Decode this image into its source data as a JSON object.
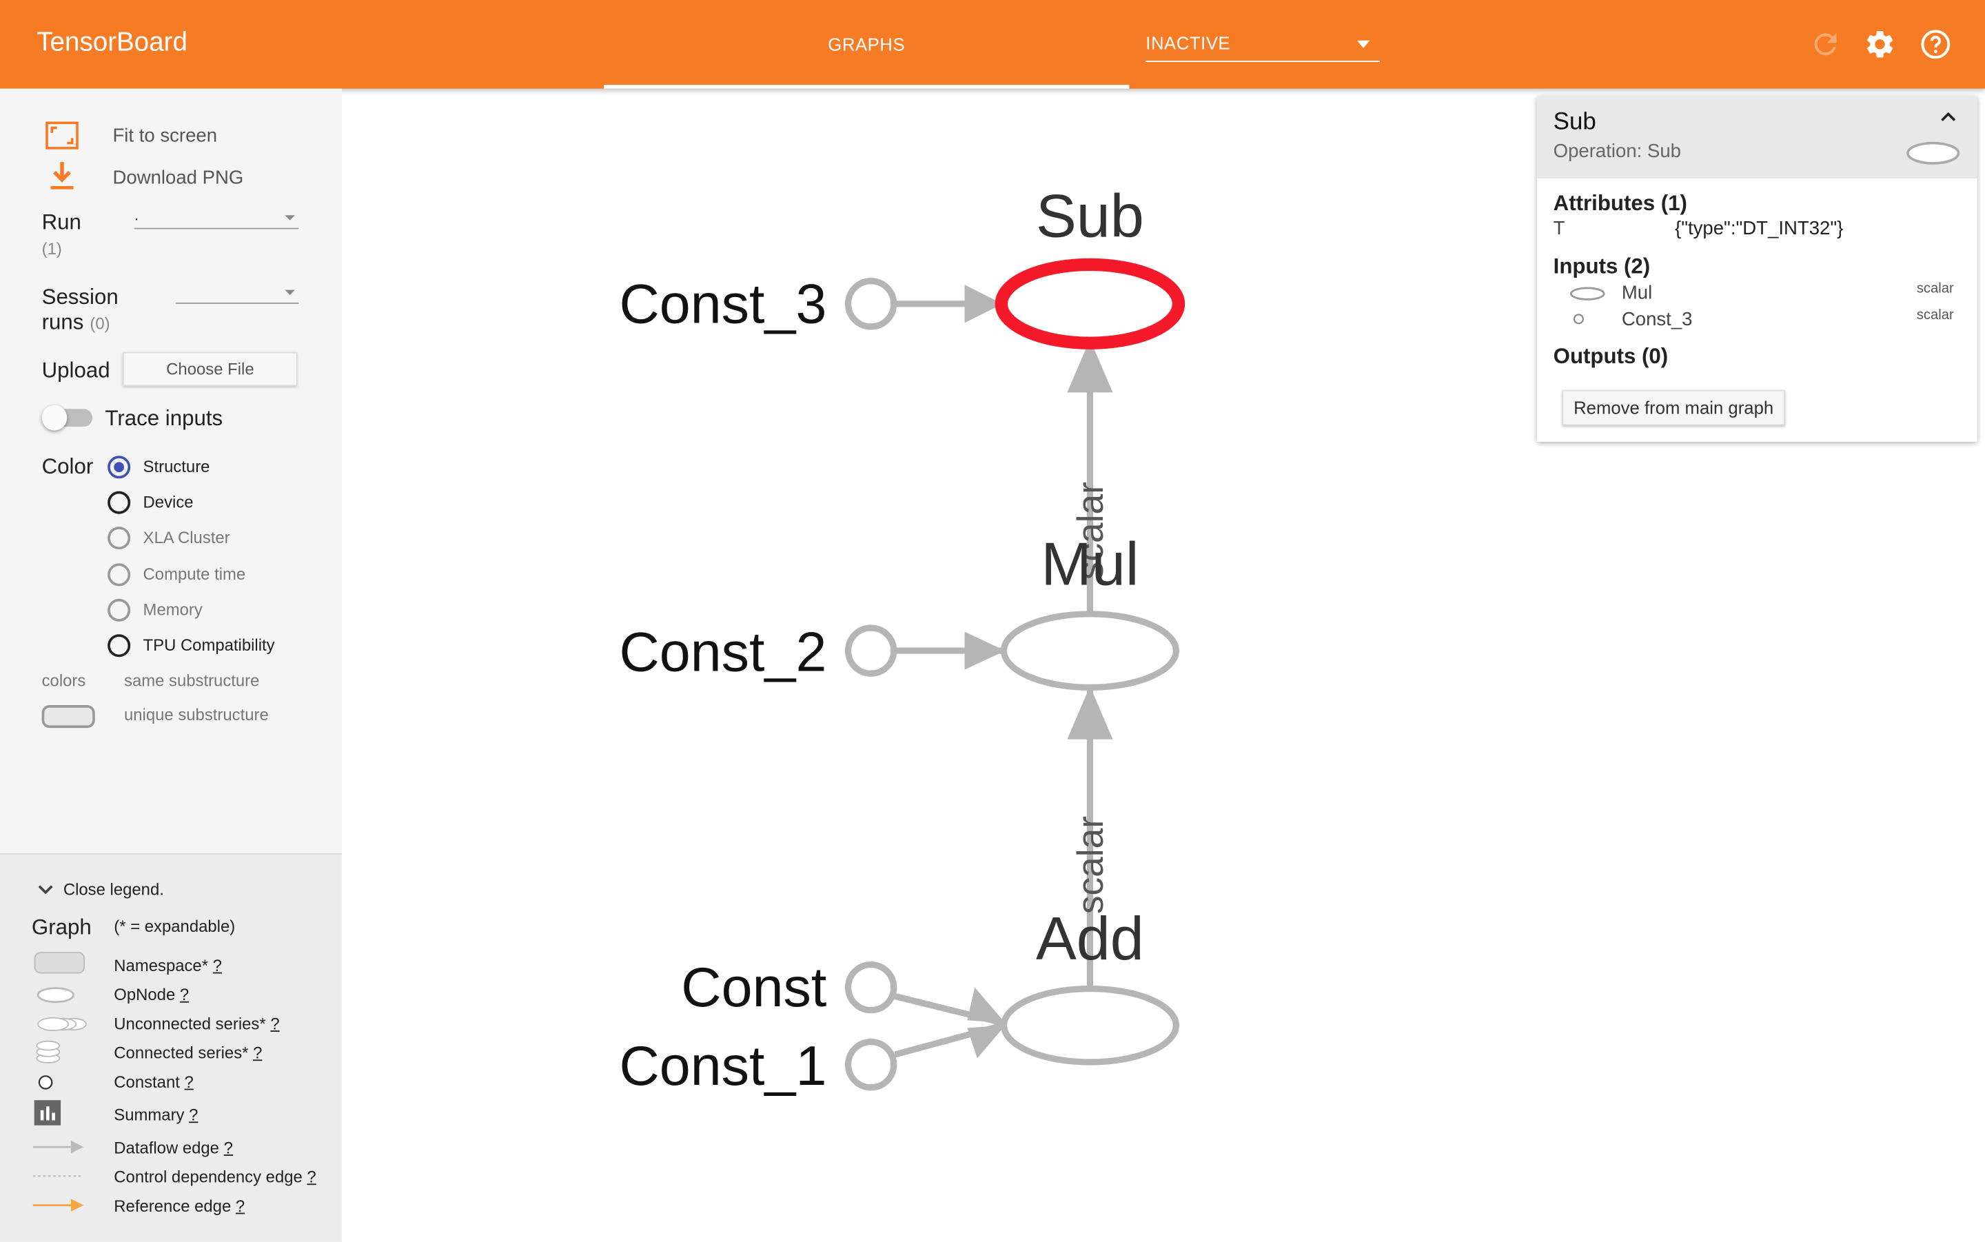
{
  "header": {
    "brand": "TensorBoard",
    "tab_graphs": "GRAPHS",
    "run_selector": "INACTIVE",
    "accent_color": "#f57c24"
  },
  "sidebar": {
    "fit_to_screen": "Fit to screen",
    "download_png": "Download PNG",
    "run_label": "Run",
    "run_count": "(1)",
    "run_value": ".",
    "session_runs_label_1": "Session",
    "session_runs_label_2": "runs",
    "session_runs_count": "(0)",
    "upload_label": "Upload",
    "choose_file": "Choose File",
    "trace_inputs": "Trace inputs",
    "color_label": "Color",
    "color_options": [
      "Structure",
      "Device",
      "XLA Cluster",
      "Compute time",
      "Memory",
      "TPU Compatibility"
    ],
    "selected_color": "Structure",
    "colors_label": "colors",
    "same_substructure": "same substructure",
    "unique_substructure": "unique substructure"
  },
  "legend": {
    "close": "Close legend.",
    "graph": "Graph",
    "expandable_note": "(* = expandable)",
    "help": "?",
    "items": [
      "Namespace*",
      "OpNode",
      "Unconnected series*",
      "Connected series*",
      "Constant",
      "Summary",
      "Dataflow edge",
      "Control dependency edge",
      "Reference edge"
    ]
  },
  "graph": {
    "nodes": {
      "sub": "Sub",
      "mul": "Mul",
      "add": "Add",
      "const": "Const",
      "const_1": "Const_1",
      "const_2": "Const_2",
      "const_3": "Const_3"
    },
    "edge_label": "scalar",
    "selected_color": "#f51a2a",
    "node_color": "#b5b5b5"
  },
  "info_card": {
    "title": "Sub",
    "operation": "Operation: Sub",
    "attributes_header": "Attributes (1)",
    "attribute_key": "T",
    "attribute_value": "{\"type\":\"DT_INT32\"}",
    "inputs_header": "Inputs (2)",
    "inputs": [
      {
        "name": "Mul",
        "shape": "scalar"
      },
      {
        "name": "Const_3",
        "shape": "scalar"
      }
    ],
    "outputs_header": "Outputs (0)",
    "remove_button": "Remove from main graph"
  }
}
